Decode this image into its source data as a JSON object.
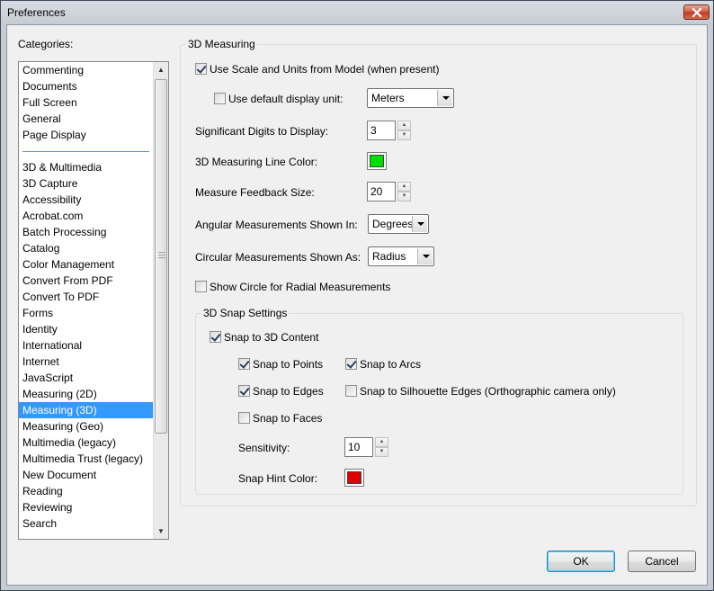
{
  "window": {
    "title": "Preferences"
  },
  "colors": {
    "selection": "#3399ff",
    "line_color": "#00e000",
    "snap_hint_color": "#e00000"
  },
  "categories": {
    "label": "Categories:",
    "group1": [
      "Commenting",
      "Documents",
      "Full Screen",
      "General",
      "Page Display"
    ],
    "group2": [
      "3D & Multimedia",
      "3D Capture",
      "Accessibility",
      "Acrobat.com",
      "Batch Processing",
      "Catalog",
      "Color Management",
      "Convert From PDF",
      "Convert To PDF",
      "Forms",
      "Identity",
      "International",
      "Internet",
      "JavaScript",
      "Measuring (2D)",
      "Measuring (3D)",
      "Measuring (Geo)",
      "Multimedia (legacy)",
      "Multimedia Trust (legacy)",
      "New Document",
      "Reading",
      "Reviewing",
      "Search"
    ],
    "selected": "Measuring (3D)"
  },
  "measuring": {
    "group_title": "3D Measuring",
    "use_scale_label": "Use Scale and Units from Model (when present)",
    "use_scale_checked": true,
    "default_unit_label": "Use default display unit:",
    "default_unit_checked": false,
    "default_unit_value": "Meters",
    "sig_digits_label": "Significant Digits to Display:",
    "sig_digits_value": "3",
    "line_color_label": "3D Measuring Line Color:",
    "feedback_size_label": "Measure Feedback Size:",
    "feedback_size_value": "20",
    "angular_label": "Angular Measurements Shown In:",
    "angular_value": "Degrees",
    "circular_label": "Circular Measurements Shown As:",
    "circular_value": "Radius",
    "show_circle_label": "Show Circle for Radial Measurements",
    "show_circle_checked": false
  },
  "snap": {
    "group_title": "3D Snap Settings",
    "snap_content_label": "Snap to 3D Content",
    "snap_content_checked": true,
    "points_label": "Snap to Points",
    "points_checked": true,
    "arcs_label": "Snap to Arcs",
    "arcs_checked": true,
    "edges_label": "Snap to Edges",
    "edges_checked": true,
    "silhouette_label": "Snap to Silhouette Edges (Orthographic camera only)",
    "silhouette_checked": false,
    "faces_label": "Snap to Faces",
    "faces_checked": false,
    "sensitivity_label": "Sensitivity:",
    "sensitivity_value": "10",
    "hint_color_label": "Snap Hint Color:"
  },
  "buttons": {
    "ok": "OK",
    "cancel": "Cancel"
  }
}
